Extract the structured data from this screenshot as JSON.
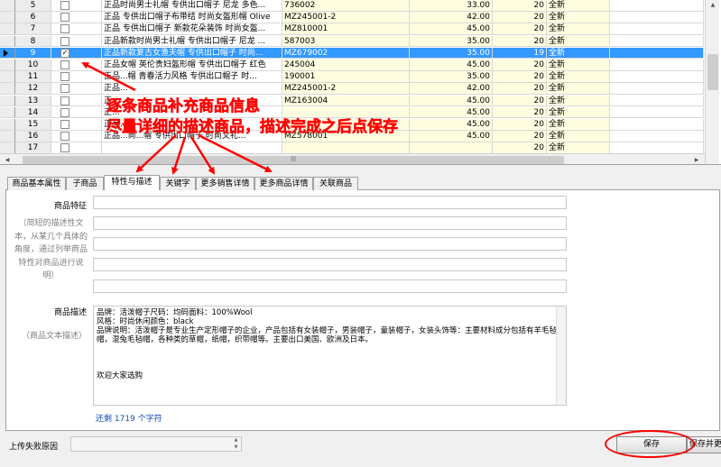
{
  "grid": {
    "rows": [
      {
        "num": "5",
        "checked": false,
        "selected": false,
        "name": "正品时尚男士礼帽 专供出口帽子 尼龙 多色...",
        "sku": "736002",
        "price": "33.00",
        "qty": "20",
        "status": "全新"
      },
      {
        "num": "6",
        "checked": false,
        "selected": false,
        "name": "正品 专供出口帽子布带结 时尚女盔形帽 Olive",
        "sku": "MZ245001-2",
        "price": "42.00",
        "qty": "20",
        "status": "全新"
      },
      {
        "num": "7",
        "checked": false,
        "selected": false,
        "name": "正品 专供出口帽子 新款花朵装饰 时尚女盔...",
        "sku": "MZ810001",
        "price": "45.00",
        "qty": "20",
        "status": "全新"
      },
      {
        "num": "8",
        "checked": false,
        "selected": false,
        "name": "正品新款时尚男士礼帽 专供出口帽子 尼龙 ...",
        "sku": "587003",
        "price": "35.00",
        "qty": "20",
        "status": "全新"
      },
      {
        "num": "9",
        "checked": true,
        "selected": true,
        "name": "正品新款复古女渔夫帽 专供出口帽子 时尚...",
        "sku": "MZ679002",
        "price": "35.00",
        "qty": "19",
        "status": "全新"
      },
      {
        "num": "10",
        "checked": false,
        "selected": false,
        "name": "正品女帽 英伦贵妇盔形帽 专供出口帽子 红色",
        "sku": "245004",
        "price": "45.00",
        "qty": "20",
        "status": "全新"
      },
      {
        "num": "11",
        "checked": false,
        "selected": false,
        "name": "正品...帽 青春活力风格 专供出口帽子 时...",
        "sku": "190001",
        "price": "35.00",
        "qty": "20",
        "status": "全新"
      },
      {
        "num": "12",
        "checked": false,
        "selected": false,
        "name": "正品...",
        "sku": "MZ245001-2",
        "price": "42.00",
        "qty": "20",
        "status": "全新"
      },
      {
        "num": "13",
        "checked": false,
        "selected": false,
        "name": "正...",
        "sku": "MZ163004",
        "price": "45.00",
        "qty": "20",
        "status": "全新"
      },
      {
        "num": "14",
        "checked": false,
        "selected": false,
        "name": "正...",
        "sku": "",
        "price": "45.00",
        "qty": "20",
        "status": "全新"
      },
      {
        "num": "15",
        "checked": false,
        "selected": false,
        "name": "正品...",
        "sku": "",
        "price": "45.00",
        "qty": "20",
        "status": "全新"
      },
      {
        "num": "16",
        "checked": false,
        "selected": false,
        "name": "正品...尚...帽 专供出口帽子 时尚文礼...",
        "sku": "MZ578001",
        "price": "45.00",
        "qty": "20",
        "status": "全新"
      },
      {
        "num": "17",
        "checked": false,
        "selected": false,
        "name": "",
        "sku": "",
        "price": "",
        "qty": "20",
        "status": "全新"
      }
    ]
  },
  "annotation": {
    "line1": "逐条商品补充商品信息",
    "line2": "尽量详细的描述商品，描述完成之后点保存"
  },
  "tabs": [
    {
      "label": "商品基本属性",
      "active": false
    },
    {
      "label": "子商品",
      "active": false
    },
    {
      "label": "特性与描述",
      "active": true
    },
    {
      "label": "关键字",
      "active": false
    },
    {
      "label": "更多销售详情",
      "active": false
    },
    {
      "label": "更多商品详情",
      "active": false
    },
    {
      "label": "关联商品",
      "active": false
    }
  ],
  "features": {
    "label": "商品特征",
    "hint": "（简短的描述性文本，从某几个具体的角度，通过列举商品特性对商品进行说明）"
  },
  "description": {
    "label": "商品描述",
    "hint": "（商品文本描述）",
    "lines": [
      "品牌：活泼帽子尺码：均码面料：100%Wool",
      "风格：时尚休闲颜色：black",
      "品牌说明：活泼帽子是专业生产定形帽子的企业，产品包括有女装帽子，男装帽子，童装帽子，女装头饰等：主要材料成分包括有羊毛毡帽，混兔毛毡帽，各种类的草帽，纸帽，织带帽等。主要出口美国、欧洲及日本。",
      "",
      "",
      "",
      "欢迎大家选购"
    ],
    "counter": "还剩 1719 个字符"
  },
  "bottom": {
    "fail_label": "上传失败原因",
    "save_label": "保存",
    "save_next_label": "保存并更"
  },
  "colors": {
    "selection": "#3399ff",
    "annotation": "#ff0000",
    "yellow_cell": "#fffde0"
  }
}
